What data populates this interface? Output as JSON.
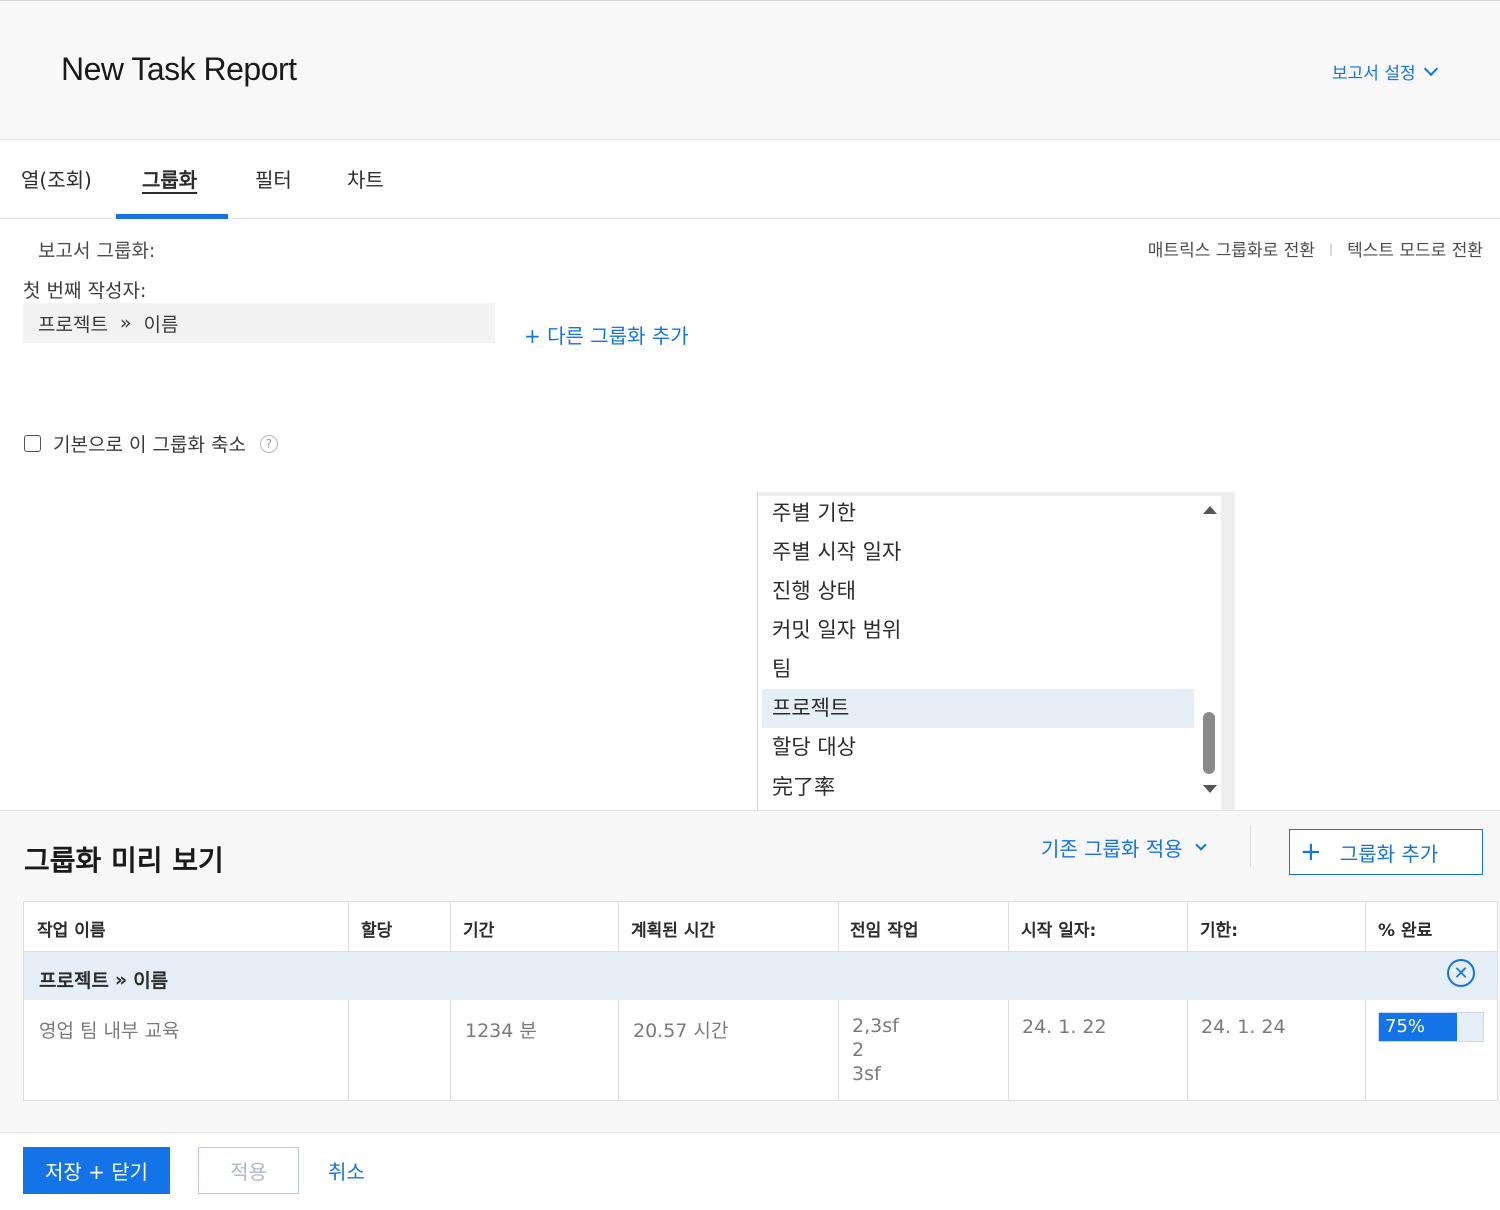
{
  "header": {
    "title": "New Task Report",
    "report_settings": "보고서 설정"
  },
  "tabs": [
    {
      "label": "열(조회)"
    },
    {
      "label": "그룹화"
    },
    {
      "label": "필터"
    },
    {
      "label": "차트"
    }
  ],
  "grouping": {
    "report_grouping_label": "보고서 그룹화:",
    "switch_matrix": "매트릭스 그룹화로 전환",
    "switch_text": "텍스트 모드로 전환",
    "first_by_label": "첫 번째 작성자:",
    "field_part1": "프로젝트",
    "field_sep": "»",
    "field_part2": "이름",
    "add_another": "+ 다른 그룹화 추가",
    "collapse_label": "기본으로 이 그룹화 축소",
    "help_glyph": "?"
  },
  "dropdown": {
    "items": [
      {
        "label": "주별 기한"
      },
      {
        "label": "주별 시작 일자"
      },
      {
        "label": "진행 상태"
      },
      {
        "label": "커밋 일자 범위"
      },
      {
        "label": "팀"
      },
      {
        "label": "프로젝트"
      },
      {
        "label": "할당 대상"
      },
      {
        "label": "完了率"
      }
    ],
    "selected": "프로젝트"
  },
  "preview": {
    "title": "그룹화 미리 보기",
    "apply_existing": "기존 그룹화 적용",
    "add_grouping": "그룹화 추가",
    "columns": [
      "작업 이름",
      "할당",
      "기간",
      "계획된 시간",
      "전임 작업",
      "시작 일자:",
      "기한:",
      "% 완료"
    ],
    "group_row": {
      "part1": "프로젝트",
      "sep": "»",
      "part2": "이름"
    },
    "row": {
      "task_name": "영업 팀 내부 교육",
      "assign": "",
      "duration": "1234 분",
      "planned_hours": "20.57 시간",
      "predecessors": [
        "2,3sf",
        "2",
        "3sf"
      ],
      "start_date": "24. 1. 22",
      "due_date": "24. 1. 24",
      "percent_complete": "75%",
      "percent_value": 0.75
    }
  },
  "footer": {
    "save_close": "저장 + 닫기",
    "apply": "적용",
    "cancel": "취소"
  },
  "colors": {
    "accent": "#1473e6",
    "selected_bg": "#e6eef8"
  }
}
